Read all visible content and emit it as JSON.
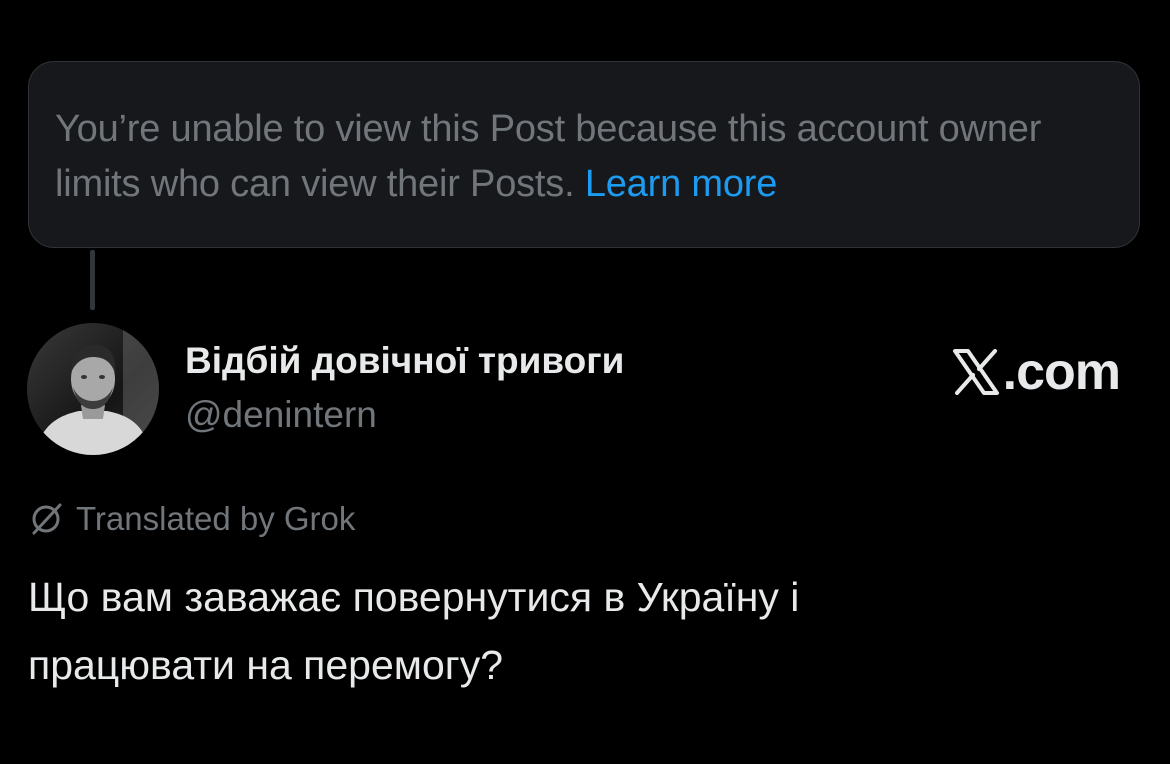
{
  "notice": {
    "text": "You’re unable to view this Post because this account owner limits who can view their Posts. ",
    "link_label": "Learn more"
  },
  "author": {
    "display_name": "Відбій довічної тривоги",
    "handle": "@denintern",
    "avatar_icon": "profile-photo"
  },
  "brand": {
    "icon": "x-logo-icon",
    "text": ".com"
  },
  "translation": {
    "icon": "grok-icon",
    "label": "Translated by Grok"
  },
  "post": {
    "text": "Що вам заважає повернутися в Україну і працювати на перемогу?"
  },
  "colors": {
    "background": "#000000",
    "card_background": "#16181c",
    "muted_text": "#71767b",
    "primary_text": "#e7e9ea",
    "link": "#1d9bf0"
  }
}
